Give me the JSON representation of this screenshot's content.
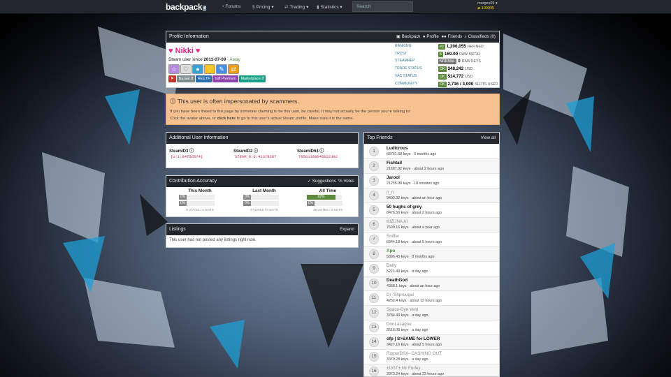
{
  "topbar": {
    "logo": "backpack",
    "logo_badge": "tf",
    "forums": "Forums",
    "pricing": "Pricing",
    "trading": "Trading",
    "statistics": "Statistics",
    "search_placeholder": "Search",
    "username": "marges69",
    "currency": "109095"
  },
  "profile": {
    "header": "Profile Information",
    "tabs": [
      "Backpack",
      "Profile",
      "Friends",
      "Classifieds (0)"
    ],
    "name": "♥ Nikki ♥",
    "since_prefix": "Steam user since ",
    "since_date": "2011-07-09",
    "status": "Away",
    "links": [
      "Bazaar.tf",
      "Rep.TF",
      "Gift Premium",
      "Marketplace.tf"
    ]
  },
  "stats": [
    {
      "label": "RANKING",
      "badge": "#3",
      "value": "1,206,055",
      "unit": "REFINED"
    },
    {
      "label": "TRUST",
      "badge": "5",
      "value": "169.00",
      "unit": "RAW METAL"
    },
    {
      "label": "STEAMREP",
      "badge": "NORMAL",
      "value": "0",
      "unit": "RAW KEYS"
    },
    {
      "label": "TRADE STATUS",
      "badge": "OK",
      "value": "$48,242",
      "unit": "USD"
    },
    {
      "label": "VAC STATUS",
      "badge": "OK",
      "value": "$14,772",
      "unit": "USD"
    },
    {
      "label": "COMMUNITY",
      "badge": "OK",
      "value": "2,716 / 3,000",
      "unit": "SLOTS USED"
    }
  ],
  "warning": {
    "title": "This user is often impersonated by scammers.",
    "line1": "If you have been linked to this page by someone claiming to be this user, be careful. It may not actually be the person you're talking to!",
    "line2_a": "Click the avatar above, or ",
    "line2_link": "click here",
    "line2_b": " to go to this user's actual Steam profile. Make sure it is the same."
  },
  "additional": {
    "header": "Additional User Information",
    "steamid3_label": "SteamID3",
    "steamid3": "[U:1:84756574]",
    "steamid2_label": "SteamID2",
    "steamid2": "STEAM_0:0:42378287",
    "steamid64_label": "SteamID64",
    "steamid64": "76561198045022302"
  },
  "contribution": {
    "header": "Contribution Accuracy",
    "suggestions": "Suggestions",
    "votes": "Votes",
    "cols": [
      {
        "title": "This Month",
        "p1": "0%",
        "p2": "0%",
        "votes": "0 VOTES / 0 SGTS"
      },
      {
        "title": "Last Month",
        "p1": "0%",
        "p2": "0%",
        "votes": "0 VOTES / 0 SGTS"
      },
      {
        "title": "All Time",
        "p1": "82%",
        "p2": "0%",
        "votes": "39 VOTES / 0 SGTS"
      }
    ],
    "all_time_accuracy": 0.82
  },
  "listings": {
    "header": "Listings",
    "expand": "Expand",
    "empty": "This user has not posted any listings right now."
  },
  "friends": {
    "header": "Top Friends",
    "view_all": "View all",
    "rows": [
      {
        "n": "1",
        "name": "Ludicrous",
        "keys": "68751.58 keys",
        "time": "6 months ago",
        "style": "bold"
      },
      {
        "n": "2",
        "name": "Fishtail",
        "keys": "21687.02 keys",
        "time": "about 2 hours ago",
        "style": "bold"
      },
      {
        "n": "3",
        "name": "Jarool",
        "keys": "21255.98 keys",
        "time": "18 minutes ago",
        "style": "bold"
      },
      {
        "n": "4",
        "name": "n_n",
        "keys": "9403.32 keys",
        "time": "about an hour ago",
        "style": "gray"
      },
      {
        "n": "5",
        "name": "50 hughs of grey",
        "keys": "8476.56 keys",
        "time": "about 2 hours ago",
        "style": "bold"
      },
      {
        "n": "6",
        "name": "KIZUNA AI",
        "keys": "7500.16 keys",
        "time": "about a year ago",
        "style": "gray"
      },
      {
        "n": "7",
        "name": "Sniffer",
        "keys": "6344.18 keys",
        "time": "about 5 hours ago",
        "style": "gray"
      },
      {
        "n": "8",
        "name": "Apo",
        "keys": "5896.45 keys",
        "time": "8 months ago",
        "style": "green"
      },
      {
        "n": "9",
        "name": "Baity",
        "keys": "5221.49 keys",
        "time": "a day ago",
        "style": "gray"
      },
      {
        "n": "10",
        "name": "DeathGod",
        "keys": "4368.1 keys",
        "time": "about an hour ago",
        "style": "bold"
      },
      {
        "n": "11",
        "name": "Dr_Shprougal",
        "keys": "4252.4 keys",
        "time": "about 12 hours ago",
        "style": "gray"
      },
      {
        "n": "12",
        "name": "Space-Dye Vest",
        "keys": "3784.49 keys",
        "time": "a day ago",
        "style": "gray"
      },
      {
        "n": "13",
        "name": "DonLasagne",
        "keys": "3516.08 keys",
        "time": "a day ago",
        "style": "gray"
      },
      {
        "n": "14",
        "name": "ofp | S>SAME for LOWER",
        "keys": "3427.16 keys",
        "time": "about 5 hours ago",
        "style": "bold"
      },
      {
        "n": "15",
        "name": "RipperDSX- CASHING OUT",
        "keys": "3379.28 keys",
        "time": "a day ago",
        "style": "gray"
      },
      {
        "n": "16",
        "name": "±UGT± Mr Furley",
        "keys": "2973.24 keys",
        "time": "about 23 hours ago",
        "style": "gray"
      }
    ]
  }
}
